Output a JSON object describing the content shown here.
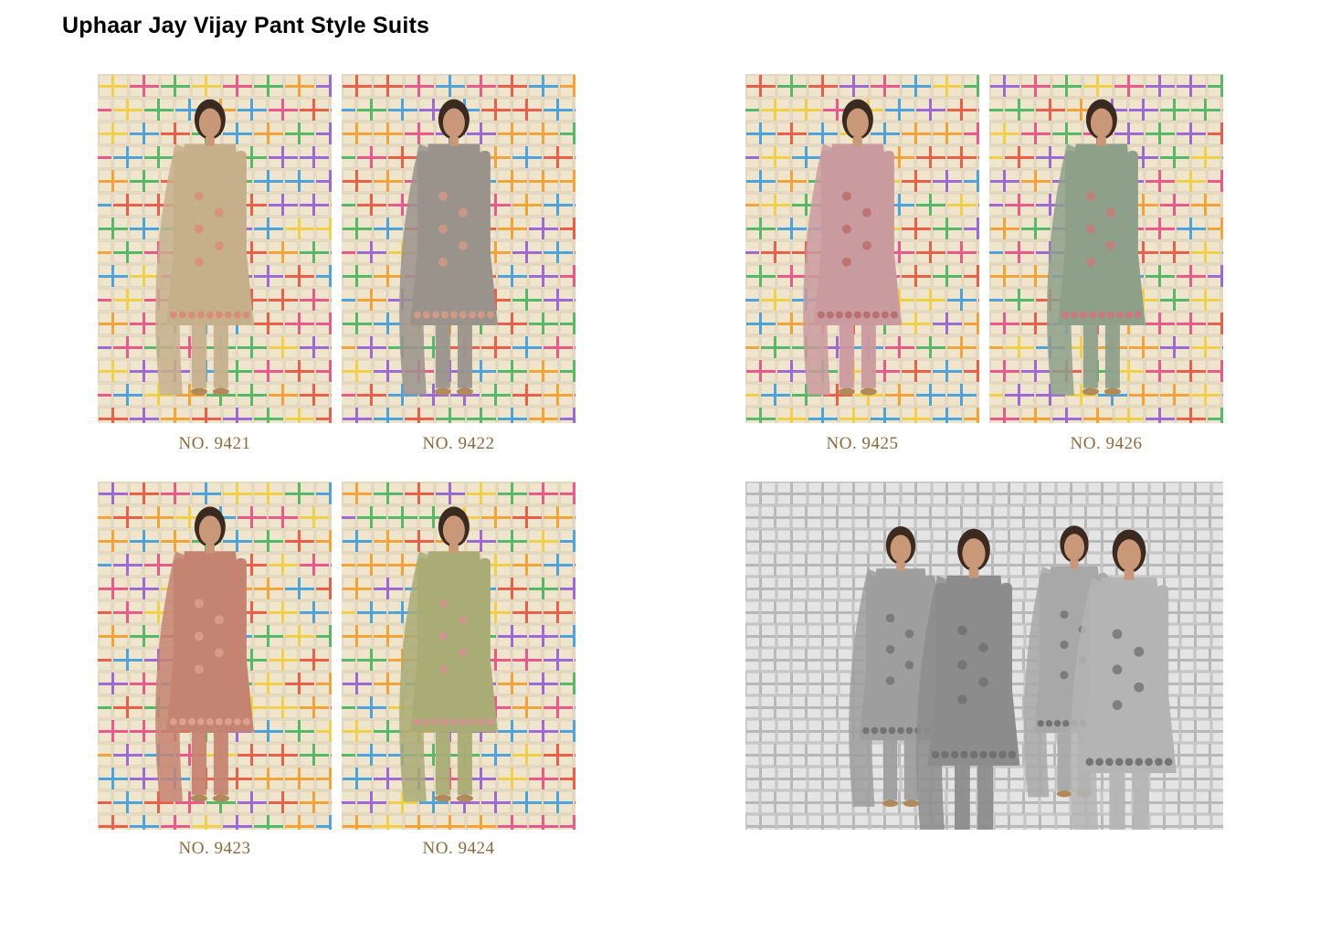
{
  "page": {
    "title": "Uphaar Jay Vijay Pant Style Suits"
  },
  "catalog": [
    {
      "label": "NO. 9421",
      "dress": "#c6b08c",
      "accent": "#d98a7a",
      "bg": "#efe6d2"
    },
    {
      "label": "NO. 9422",
      "dress": "#9a938c",
      "accent": "#d99a86",
      "bg": "#ece3d0"
    },
    {
      "label": "NO. 9425",
      "dress": "#c99a9e",
      "accent": "#b86a6a",
      "bg": "#efe5d1"
    },
    {
      "label": "NO. 9426",
      "dress": "#8ea08a",
      "accent": "#d0757a",
      "bg": "#ede4d0"
    },
    {
      "label": "NO. 9423",
      "dress": "#c58472",
      "accent": "#e0a28e",
      "bg": "#eee4cf"
    },
    {
      "label": "NO. 9424",
      "dress": "#a9ac74",
      "accent": "#d39490",
      "bg": "#ece3cd"
    }
  ],
  "group_photo": {
    "tone": "grayscale"
  }
}
